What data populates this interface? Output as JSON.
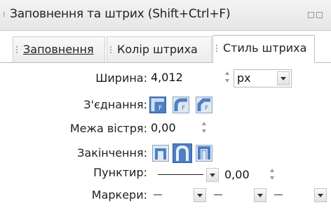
{
  "dialog": {
    "title": "Заповнення та штрих (Shift+Ctrl+F)"
  },
  "tabs": [
    {
      "label": "Заповнення"
    },
    {
      "label": "Колір штриха"
    },
    {
      "label": "Стиль штриха",
      "active": true
    }
  ],
  "stroke_style": {
    "width_label": "Ширина:",
    "width_value": "4,012",
    "unit_value": "px",
    "join_label": "З'єднання:",
    "join_selected": "miter",
    "join_icons": [
      "miter-join-icon",
      "round-join-icon",
      "bevel-join-icon"
    ],
    "miter_label": "Межа вістря:",
    "miter_value": "0,00",
    "cap_label": "Закінчення:",
    "cap_selected": "round",
    "cap_icons": [
      "butt-cap-icon",
      "round-cap-icon",
      "square-cap-icon"
    ],
    "dash_label": "Пунктир:",
    "dash_offset_value": "0,00",
    "markers_label": "Маркери:"
  },
  "colors": {
    "selected_button": "#4d7fc1",
    "unselected_button": "#dfe8f3"
  }
}
